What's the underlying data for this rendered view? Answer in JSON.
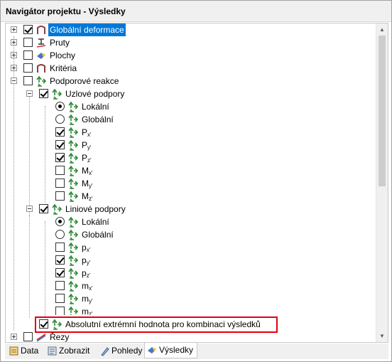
{
  "window": {
    "title": "Navigátor projektu - Výsledky"
  },
  "tree": {
    "globalni_deformace": "Globální deformace",
    "pruty": "Pruty",
    "plochy": "Plochy",
    "kriteria": "Kritéria",
    "podporove_reakce": "Podporové reakce",
    "uzlove_podpory": "Uzlové podpory",
    "uzlove_lokalni": "Lokální",
    "uzlove_globalni": "Globální",
    "px_base": "P",
    "px_sub": "x'",
    "py_base": "P",
    "py_sub": "y'",
    "pz_base": "P",
    "pz_sub": "z'",
    "mx_base": "M",
    "mx_sub": "x'",
    "my_base": "M",
    "my_sub": "y'",
    "mz_base": "M",
    "mz_sub": "z'",
    "liniove_podpory": "Liniové podpory",
    "liniove_lokalni": "Lokální",
    "liniove_globalni": "Globální",
    "lpx_base": "p",
    "lpx_sub": "x'",
    "lpy_base": "p",
    "lpy_sub": "y'",
    "lpz_base": "p",
    "lpz_sub": "z'",
    "lmx_base": "m",
    "lmx_sub": "x'",
    "lmy_base": "m",
    "lmy_sub": "y'",
    "lmz_base": "m",
    "lmz_sub": "z'",
    "absolutni": "Absolutní extrémní hodnota pro kombinaci výsledků",
    "rezy": "Řezy"
  },
  "tabs": {
    "data": "Data",
    "zobrazit": "Zobrazit",
    "pohledy": "Pohledy",
    "vysledky": "Výsledky"
  },
  "colors": {
    "selection": "#0078d7",
    "highlight_border": "#e3000f",
    "support_icon": "#2e8b3a"
  }
}
